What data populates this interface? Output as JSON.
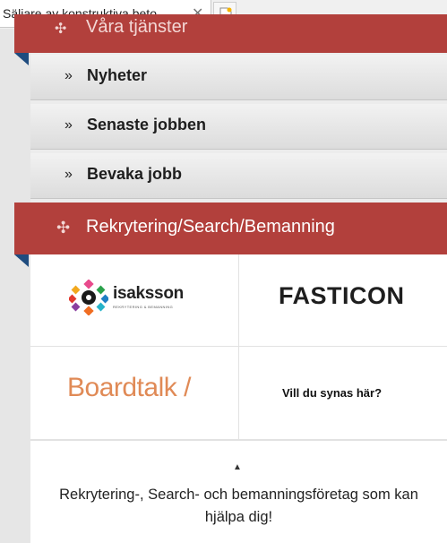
{
  "tab": {
    "title": "Säljare av konstruktiva beto…",
    "close_glyph": "✕"
  },
  "nav": {
    "section_title": "Våra tjänster",
    "section_icon": "move-arrows-icon",
    "items": [
      {
        "label": "Nyheter"
      },
      {
        "label": "Senaste jobben"
      },
      {
        "label": "Bevaka jobb"
      }
    ],
    "chevron_glyph": "»"
  },
  "recruitment": {
    "title": "Rekrytering/Search/Bemanning",
    "icon": "move-arrows-icon"
  },
  "partners": {
    "isaksson": {
      "name": "isaksson",
      "tagline": "REKRYTERING & BEMANNING"
    },
    "fasticon": {
      "name": "FASTICON"
    },
    "boardtalk": {
      "name": "Boardtalk /"
    },
    "placeholder": {
      "text": "Vill du synas här?"
    }
  },
  "footer": {
    "text": "Rekrytering-, Search- och bemanningsföretag som kan hjälpa dig!"
  },
  "colors": {
    "accent_red": "#b2403c",
    "fold_blue": "#1f4c7f",
    "boardtalk_orange": "#e08a56"
  }
}
